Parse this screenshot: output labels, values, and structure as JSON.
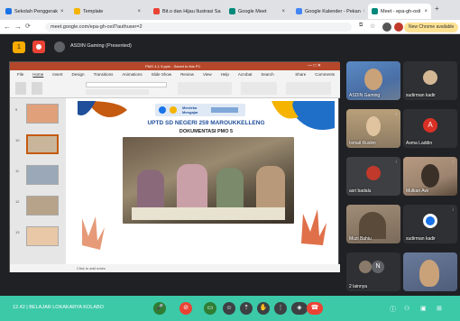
{
  "browser": {
    "tabs": [
      {
        "label": "Sekolah Penggerak",
        "color": "#1a73e8"
      },
      {
        "label": "Template",
        "color": "#f4b400"
      },
      {
        "label": "Bit.o dan Hijau Ilustrasi Sa",
        "color": "#ea4335"
      },
      {
        "label": "Google Meet",
        "color": "#00897b"
      },
      {
        "label": "Google Kalender - Pekan",
        "color": "#4285f4"
      },
      {
        "label": "Meet - epa-gh-oxil",
        "color": "#00897b"
      }
    ],
    "new_tab": "+",
    "url": "meet.google.com/epa-gh-oxil?authuser=2",
    "chrome_button": "New Chrome available"
  },
  "meet_header": {
    "presenter_label": "ASDIN Gaming (Presented)",
    "control_badge": "1"
  },
  "ppt": {
    "title": "PMO 4-1 9.pptx - Saved to this PC",
    "menu": [
      "File",
      "Home",
      "Insert",
      "Design",
      "Transitions",
      "Animations",
      "Slide Show",
      "Review",
      "View",
      "Help",
      "Acrobat",
      "Search"
    ],
    "share": "Share",
    "comments": "Comments",
    "status": "Click to add notes",
    "thumb_numbers": [
      "9",
      "10",
      "11",
      "12",
      "13"
    ]
  },
  "slide": {
    "logo_text": "Merdeka Mengajar",
    "school": "UPTD SD NEGERI 259 MAROUKKELLENG",
    "subtitle": "DOKUMENTASI PMO 5"
  },
  "participants": [
    {
      "name": "ASDIN Gaming",
      "kind": "photo",
      "bg": "#4a6fa5"
    },
    {
      "name": "sudirman kadir",
      "kind": "photo",
      "bg": "#2f3033"
    },
    {
      "name": "Ismail Ruslim",
      "kind": "photo",
      "bg": "#8c7a62"
    },
    {
      "name": "Asma Laddin",
      "kind": "avatar",
      "letter": "A",
      "bg": "#2f3033",
      "avatar_color": "#d93025"
    },
    {
      "name": "asri badalu",
      "kind": "photo",
      "bg": "#3e3f42"
    },
    {
      "name": "Mulkan Awi",
      "kind": "photo",
      "bg": "#9c8470"
    },
    {
      "name": "Muzi Bahiu",
      "kind": "photo",
      "bg": "#7a6a5a"
    },
    {
      "name": "sudirman kadir",
      "kind": "photo",
      "bg": "#2f3033"
    },
    {
      "name": "2 lainnya",
      "kind": "group",
      "letter": "N",
      "bg": "#2f3033"
    },
    {
      "name": "",
      "kind": "photo",
      "bg": "#4d5d7a"
    }
  ],
  "bottom_bar": {
    "time_meeting": "12.42  |  BELAJAR LOKAKARYA KOLABO",
    "color": "#3bc9a8",
    "end_call_color": "#ea4335"
  }
}
